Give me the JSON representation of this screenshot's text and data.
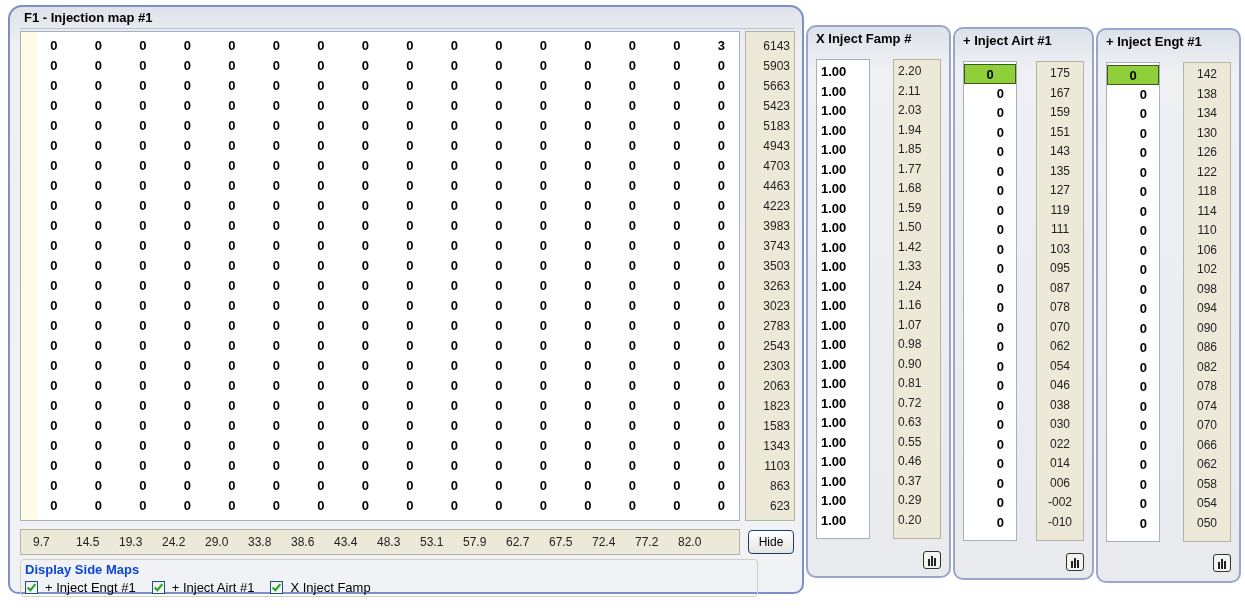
{
  "main_map": {
    "title": "F1 - Injection map #1",
    "rows": [
      [
        "0",
        "0",
        "0",
        "0",
        "0",
        "0",
        "0",
        "0",
        "0",
        "0",
        "0",
        "0",
        "0",
        "0",
        "0",
        "3"
      ],
      [
        "0",
        "0",
        "0",
        "0",
        "0",
        "0",
        "0",
        "0",
        "0",
        "0",
        "0",
        "0",
        "0",
        "0",
        "0",
        "0"
      ],
      [
        "0",
        "0",
        "0",
        "0",
        "0",
        "0",
        "0",
        "0",
        "0",
        "0",
        "0",
        "0",
        "0",
        "0",
        "0",
        "0"
      ],
      [
        "0",
        "0",
        "0",
        "0",
        "0",
        "0",
        "0",
        "0",
        "0",
        "0",
        "0",
        "0",
        "0",
        "0",
        "0",
        "0"
      ],
      [
        "0",
        "0",
        "0",
        "0",
        "0",
        "0",
        "0",
        "0",
        "0",
        "0",
        "0",
        "0",
        "0",
        "0",
        "0",
        "0"
      ],
      [
        "0",
        "0",
        "0",
        "0",
        "0",
        "0",
        "0",
        "0",
        "0",
        "0",
        "0",
        "0",
        "0",
        "0",
        "0",
        "0"
      ],
      [
        "0",
        "0",
        "0",
        "0",
        "0",
        "0",
        "0",
        "0",
        "0",
        "0",
        "0",
        "0",
        "0",
        "0",
        "0",
        "0"
      ],
      [
        "0",
        "0",
        "0",
        "0",
        "0",
        "0",
        "0",
        "0",
        "0",
        "0",
        "0",
        "0",
        "0",
        "0",
        "0",
        "0"
      ],
      [
        "0",
        "0",
        "0",
        "0",
        "0",
        "0",
        "0",
        "0",
        "0",
        "0",
        "0",
        "0",
        "0",
        "0",
        "0",
        "0"
      ],
      [
        "0",
        "0",
        "0",
        "0",
        "0",
        "0",
        "0",
        "0",
        "0",
        "0",
        "0",
        "0",
        "0",
        "0",
        "0",
        "0"
      ],
      [
        "0",
        "0",
        "0",
        "0",
        "0",
        "0",
        "0",
        "0",
        "0",
        "0",
        "0",
        "0",
        "0",
        "0",
        "0",
        "0"
      ],
      [
        "0",
        "0",
        "0",
        "0",
        "0",
        "0",
        "0",
        "0",
        "0",
        "0",
        "0",
        "0",
        "0",
        "0",
        "0",
        "0"
      ],
      [
        "0",
        "0",
        "0",
        "0",
        "0",
        "0",
        "0",
        "0",
        "0",
        "0",
        "0",
        "0",
        "0",
        "0",
        "0",
        "0"
      ],
      [
        "0",
        "0",
        "0",
        "0",
        "0",
        "0",
        "0",
        "0",
        "0",
        "0",
        "0",
        "0",
        "0",
        "0",
        "0",
        "0"
      ],
      [
        "0",
        "0",
        "0",
        "0",
        "0",
        "0",
        "0",
        "0",
        "0",
        "0",
        "0",
        "0",
        "0",
        "0",
        "0",
        "0"
      ],
      [
        "0",
        "0",
        "0",
        "0",
        "0",
        "0",
        "0",
        "0",
        "0",
        "0",
        "0",
        "0",
        "0",
        "0",
        "0",
        "0"
      ],
      [
        "0",
        "0",
        "0",
        "0",
        "0",
        "0",
        "0",
        "0",
        "0",
        "0",
        "0",
        "0",
        "0",
        "0",
        "0",
        "0"
      ],
      [
        "0",
        "0",
        "0",
        "0",
        "0",
        "0",
        "0",
        "0",
        "0",
        "0",
        "0",
        "0",
        "0",
        "0",
        "0",
        "0"
      ],
      [
        "0",
        "0",
        "0",
        "0",
        "0",
        "0",
        "0",
        "0",
        "0",
        "0",
        "0",
        "0",
        "0",
        "0",
        "0",
        "0"
      ],
      [
        "0",
        "0",
        "0",
        "0",
        "0",
        "0",
        "0",
        "0",
        "0",
        "0",
        "0",
        "0",
        "0",
        "0",
        "0",
        "0"
      ],
      [
        "0",
        "0",
        "0",
        "0",
        "0",
        "0",
        "0",
        "0",
        "0",
        "0",
        "0",
        "0",
        "0",
        "0",
        "0",
        "0"
      ],
      [
        "0",
        "0",
        "0",
        "0",
        "0",
        "0",
        "0",
        "0",
        "0",
        "0",
        "0",
        "0",
        "0",
        "0",
        "0",
        "0"
      ],
      [
        "0",
        "0",
        "0",
        "0",
        "0",
        "0",
        "0",
        "0",
        "0",
        "0",
        "0",
        "0",
        "0",
        "0",
        "0",
        "0"
      ],
      [
        "0",
        "0",
        "0",
        "0",
        "0",
        "0",
        "0",
        "0",
        "0",
        "0",
        "0",
        "0",
        "0",
        "0",
        "0",
        "0"
      ]
    ],
    "y_axis": [
      "6143",
      "5903",
      "5663",
      "5423",
      "5183",
      "4943",
      "4703",
      "4463",
      "4223",
      "3983",
      "3743",
      "3503",
      "3263",
      "3023",
      "2783",
      "2543",
      "2303",
      "2063",
      "1823",
      "1583",
      "1343",
      "1103",
      "863",
      "623"
    ],
    "x_axis": [
      "9.7",
      "14.5",
      "19.3",
      "24.2",
      "29.0",
      "33.8",
      "38.6",
      "43.4",
      "48.3",
      "53.1",
      "57.9",
      "62.7",
      "67.5",
      "72.4",
      "77.2",
      "82.0"
    ],
    "hide_button": "Hide",
    "side_maps_group": {
      "title": "Display Side Maps",
      "checkboxes": [
        {
          "label": "+ Inject Engt #1",
          "checked": true
        },
        {
          "label": "+ Inject Airt #1",
          "checked": true
        },
        {
          "label": "X Inject Famp",
          "checked": true
        }
      ]
    }
  },
  "side_maps": [
    {
      "title": "X Inject Famp #",
      "kind": "factor",
      "values": [
        {
          "value": "1.00",
          "selected": false
        },
        {
          "value": "1.00",
          "selected": false
        },
        {
          "value": "1.00",
          "selected": false
        },
        {
          "value": "1.00",
          "selected": false
        },
        {
          "value": "1.00",
          "selected": false
        },
        {
          "value": "1.00",
          "selected": false
        },
        {
          "value": "1.00",
          "selected": false
        },
        {
          "value": "1.00",
          "selected": false
        },
        {
          "value": "1.00",
          "selected": false
        },
        {
          "value": "1.00",
          "selected": false
        },
        {
          "value": "1.00",
          "selected": false
        },
        {
          "value": "1.00",
          "selected": false
        },
        {
          "value": "1.00",
          "selected": false
        },
        {
          "value": "1.00",
          "selected": false
        },
        {
          "value": "1.00",
          "selected": false
        },
        {
          "value": "1.00",
          "selected": false
        },
        {
          "value": "1.00",
          "selected": false
        },
        {
          "value": "1.00",
          "selected": false
        },
        {
          "value": "1.00",
          "selected": false
        },
        {
          "value": "1.00",
          "selected": false
        },
        {
          "value": "1.00",
          "selected": false
        },
        {
          "value": "1.00",
          "selected": false
        },
        {
          "value": "1.00",
          "selected": false
        },
        {
          "value": "1.00",
          "selected": false
        }
      ],
      "axis": [
        "2.20",
        "2.11",
        "2.03",
        "1.94",
        "1.85",
        "1.77",
        "1.68",
        "1.59",
        "1.50",
        "1.42",
        "1.33",
        "1.24",
        "1.16",
        "1.07",
        "0.98",
        "0.90",
        "0.81",
        "0.72",
        "0.63",
        "0.55",
        "0.46",
        "0.37",
        "0.29",
        "0.20"
      ]
    },
    {
      "title": "+ Inject Airt #1",
      "kind": "offset",
      "values": [
        {
          "value": "0",
          "selected": true
        },
        {
          "value": "0",
          "selected": false
        },
        {
          "value": "0",
          "selected": false
        },
        {
          "value": "0",
          "selected": false
        },
        {
          "value": "0",
          "selected": false
        },
        {
          "value": "0",
          "selected": false
        },
        {
          "value": "0",
          "selected": false
        },
        {
          "value": "0",
          "selected": false
        },
        {
          "value": "0",
          "selected": false
        },
        {
          "value": "0",
          "selected": false
        },
        {
          "value": "0",
          "selected": false
        },
        {
          "value": "0",
          "selected": false
        },
        {
          "value": "0",
          "selected": false
        },
        {
          "value": "0",
          "selected": false
        },
        {
          "value": "0",
          "selected": false
        },
        {
          "value": "0",
          "selected": false
        },
        {
          "value": "0",
          "selected": false
        },
        {
          "value": "0",
          "selected": false
        },
        {
          "value": "0",
          "selected": false
        },
        {
          "value": "0",
          "selected": false
        },
        {
          "value": "0",
          "selected": false
        },
        {
          "value": "0",
          "selected": false
        },
        {
          "value": "0",
          "selected": false
        },
        {
          "value": "0",
          "selected": false
        }
      ],
      "axis": [
        "175",
        "167",
        "159",
        "151",
        "143",
        "135",
        "127",
        "119",
        "111",
        "103",
        "095",
        "087",
        "078",
        "070",
        "062",
        "054",
        "046",
        "038",
        "030",
        "022",
        "014",
        "006",
        "-002",
        "-010"
      ]
    },
    {
      "title": "+ Inject Engt #1",
      "kind": "offset",
      "values": [
        {
          "value": "0",
          "selected": true
        },
        {
          "value": "0",
          "selected": false
        },
        {
          "value": "0",
          "selected": false
        },
        {
          "value": "0",
          "selected": false
        },
        {
          "value": "0",
          "selected": false
        },
        {
          "value": "0",
          "selected": false
        },
        {
          "value": "0",
          "selected": false
        },
        {
          "value": "0",
          "selected": false
        },
        {
          "value": "0",
          "selected": false
        },
        {
          "value": "0",
          "selected": false
        },
        {
          "value": "0",
          "selected": false
        },
        {
          "value": "0",
          "selected": false
        },
        {
          "value": "0",
          "selected": false
        },
        {
          "value": "0",
          "selected": false
        },
        {
          "value": "0",
          "selected": false
        },
        {
          "value": "0",
          "selected": false
        },
        {
          "value": "0",
          "selected": false
        },
        {
          "value": "0",
          "selected": false
        },
        {
          "value": "0",
          "selected": false
        },
        {
          "value": "0",
          "selected": false
        },
        {
          "value": "0",
          "selected": false
        },
        {
          "value": "0",
          "selected": false
        },
        {
          "value": "0",
          "selected": false
        },
        {
          "value": "0",
          "selected": false
        }
      ],
      "axis": [
        "142",
        "138",
        "134",
        "130",
        "126",
        "122",
        "118",
        "114",
        "110",
        "106",
        "102",
        "098",
        "094",
        "090",
        "086",
        "082",
        "078",
        "074",
        "070",
        "066",
        "062",
        "058",
        "054",
        "050"
      ]
    }
  ]
}
